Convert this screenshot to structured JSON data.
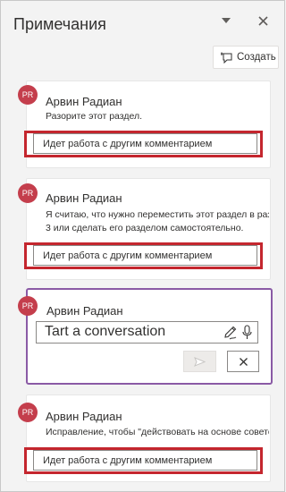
{
  "pane": {
    "title": "Примечания",
    "create_label": "Создать"
  },
  "comments": [
    {
      "initials": "PR",
      "author": "Арвин Радиан",
      "lines": [
        "Разорите этот раздел."
      ],
      "reply": "Идет работа с другим комментарием"
    },
    {
      "initials": "PR",
      "author": "Арвин Радиан",
      "lines": [
        "Я считаю, что нужно переместить этот раздел в раздел",
        "3 или сделать его разделом самостоятельно."
      ],
      "reply": "Идет работа с другим комментарием"
    },
    {
      "initials": "PR",
      "author": "Арвин Радиан",
      "placeholder": "Tart a conversation"
    },
    {
      "initials": "PR",
      "author": "Арвин Радиан",
      "lines": [
        "Исправление, чтобы \"действовать на основе советов\""
      ],
      "reply": "Идет работа с другим комментарием"
    }
  ],
  "colors": {
    "avatar": "#c43e4c",
    "active_border": "#8a5aa5",
    "highlight": "#c4262e"
  }
}
